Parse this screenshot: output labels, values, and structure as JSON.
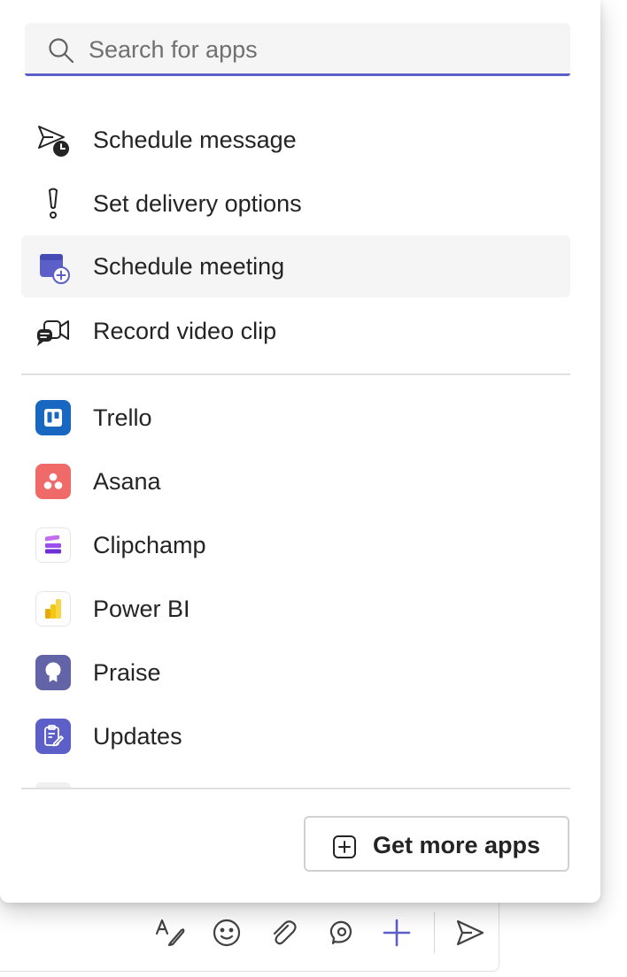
{
  "search": {
    "placeholder": "Search for apps",
    "value": ""
  },
  "actions": [
    {
      "label": "Schedule message",
      "icon": "send-clock-icon"
    },
    {
      "label": "Set delivery options",
      "icon": "exclamation-icon"
    },
    {
      "label": "Schedule meeting",
      "icon": "calendar-add-icon",
      "highlighted": true
    },
    {
      "label": "Record video clip",
      "icon": "video-clip-icon"
    }
  ],
  "apps": [
    {
      "label": "Trello",
      "icon": "trello-icon",
      "color": "#1867c0"
    },
    {
      "label": "Asana",
      "icon": "asana-icon",
      "color": "#f06a6a"
    },
    {
      "label": "Clipchamp",
      "icon": "clipchamp-icon",
      "color": "#7b3ff2"
    },
    {
      "label": "Power BI",
      "icon": "power-bi-icon",
      "color": "#f2c811"
    },
    {
      "label": "Praise",
      "icon": "praise-icon",
      "color": "#6264a7"
    },
    {
      "label": "Updates",
      "icon": "updates-icon",
      "color": "#5b5fc7"
    }
  ],
  "footer": {
    "get_more_label": "Get more apps",
    "icon": "add-square-icon"
  },
  "toolbar": {
    "buttons": [
      {
        "icon": "format-text-icon"
      },
      {
        "icon": "emoji-icon"
      },
      {
        "icon": "attach-icon"
      },
      {
        "icon": "loop-icon"
      },
      {
        "icon": "add-icon"
      },
      {
        "icon": "send-icon"
      }
    ]
  },
  "colors": {
    "accent": "#5b5fc7",
    "hover_bg": "#f5f5f5",
    "divider": "#e0e0e0"
  }
}
